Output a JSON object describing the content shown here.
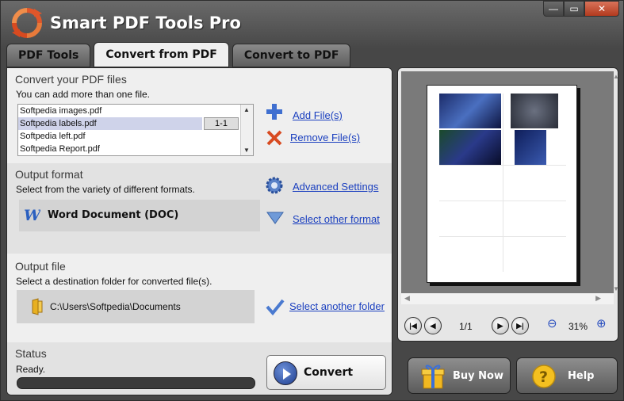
{
  "window": {
    "title": "Smart PDF Tools Pro",
    "controls": {
      "minimize": "—",
      "maximize": "▭",
      "close": "✕"
    }
  },
  "tabs": [
    {
      "label": "PDF Tools",
      "active": false
    },
    {
      "label": "Convert from PDF",
      "active": true
    },
    {
      "label": "Convert to PDF",
      "active": false
    }
  ],
  "files_section": {
    "title": "Convert your PDF files",
    "subtitle": "You can add more than one file.",
    "files": [
      {
        "name": "Softpedia images.pdf",
        "selected": false
      },
      {
        "name": "Softpedia labels.pdf",
        "selected": true,
        "page_range": "1-1"
      },
      {
        "name": "Softpedia left.pdf",
        "selected": false
      },
      {
        "name": "Softpedia Report.pdf",
        "selected": false
      }
    ],
    "add_label": "Add File(s)",
    "remove_label": "Remove File(s)"
  },
  "format_section": {
    "title": "Output format",
    "subtitle": "Select from the variety of different formats.",
    "advanced_label": "Advanced Settings",
    "selected_format": "Word Document (DOC)",
    "other_format_label": "Select other format"
  },
  "output_section": {
    "title": "Output file",
    "subtitle": "Select a destination folder for converted file(s).",
    "folder": "C:\\Users\\Softpedia\\Documents",
    "another_folder_label": "Select another folder"
  },
  "status_section": {
    "title": "Status",
    "status_text": "Ready.",
    "progress": 0,
    "convert_label": "Convert"
  },
  "preview": {
    "page_indicator": "1/1",
    "zoom": "31%"
  },
  "bottom": {
    "buy_label": "Buy Now",
    "help_label": "Help"
  },
  "colors": {
    "accent_link": "#1a3fbf",
    "window_bg": "#474747",
    "close_button": "#b33a1e"
  }
}
